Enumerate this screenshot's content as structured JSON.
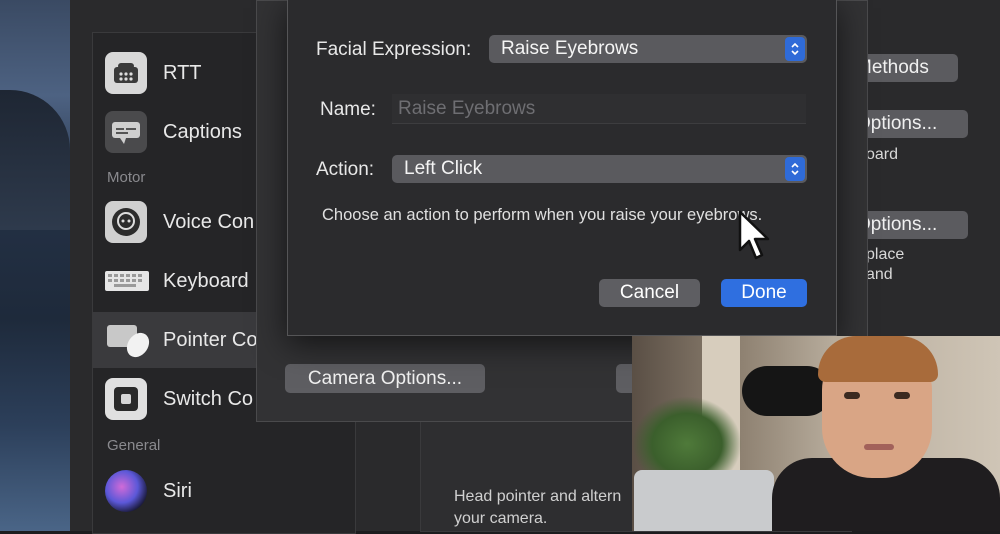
{
  "sidebar": {
    "items": [
      {
        "label": "RTT",
        "icon": "phone-icon"
      },
      {
        "label": "Captions",
        "icon": "captions-icon"
      },
      {
        "label": "Voice Con",
        "icon": "voice-control-icon"
      },
      {
        "label": "Keyboard",
        "icon": "keyboard-icon"
      },
      {
        "label": "Pointer Co",
        "icon": "pointer-control-icon"
      },
      {
        "label": "Switch Co",
        "icon": "switch-control-icon"
      },
      {
        "label": "Siri",
        "icon": "siri-icon"
      }
    ],
    "sections": {
      "motor": "Motor",
      "general": "General"
    }
  },
  "right_panel": {
    "methods_button": "Methods",
    "options_button_1": "Options...",
    "options_button_2": "Options...",
    "text_1": "oard",
    "text_2a": "place",
    "text_2b": "and",
    "hint_line_1": "Head pointer and altern",
    "hint_line_2": "your camera."
  },
  "sheet": {
    "camera_options_button": "Camera Options..."
  },
  "dialog": {
    "facial_expression_label": "Facial Expression:",
    "facial_expression_value": "Raise Eyebrows",
    "name_label": "Name:",
    "name_placeholder": "Raise Eyebrows",
    "action_label": "Action:",
    "action_value": "Left Click",
    "description": "Choose an action to perform when you raise your eyebrows.",
    "cancel_button": "Cancel",
    "done_button": "Done"
  },
  "colors": {
    "accent": "#2f6fe0",
    "window_bg": "#2a2a2c",
    "dialog_bg": "#2b2b2d"
  }
}
